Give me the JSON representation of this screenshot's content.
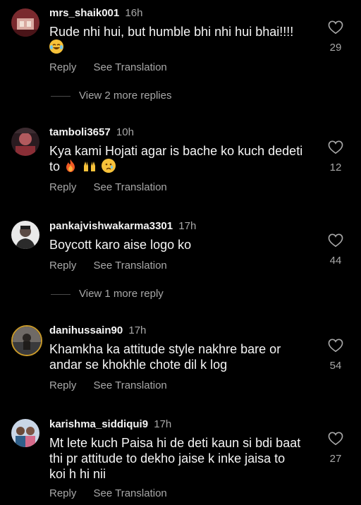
{
  "comments": [
    {
      "username": "mrs_shaik001",
      "time": "16h",
      "text": "Rude nhi hui, but humble bhi nhi hui bhai!!!!",
      "emoji": [
        "laughing-tears"
      ],
      "reply_label": "Reply",
      "translate_label": "See Translation",
      "likes": "29",
      "more_replies": "View 2 more replies"
    },
    {
      "username": "tamboli3657",
      "time": "10h",
      "text": "Kya kami Hojati agar is bache ko kuch dedeti to",
      "emoji": [
        "fire",
        "raised-hands",
        "crying-face"
      ],
      "reply_label": "Reply",
      "translate_label": "See Translation",
      "likes": "12"
    },
    {
      "username": "pankajvishwakarma3301",
      "time": "17h",
      "text": "Boycott karo aise logo ko",
      "reply_label": "Reply",
      "translate_label": "See Translation",
      "likes": "44",
      "more_replies": "View 1 more reply"
    },
    {
      "username": "danihussain90",
      "time": "17h",
      "text": "Khamkha ka attitude style nakhre bare or andar se khokhle chote dil k log",
      "reply_label": "Reply",
      "translate_label": "See Translation",
      "likes": "54"
    },
    {
      "username": "karishma_siddiqui9",
      "time": "17h",
      "text": "Mt lete kuch Paisa hi de deti kaun si bdi baat thi pr attitude to dekho jaise k inke jaisa to koi h hi nii",
      "reply_label": "Reply",
      "translate_label": "See Translation",
      "likes": "27"
    }
  ],
  "colors": {
    "background": "#000000",
    "primary_text": "#f5f5f5",
    "secondary_text": "#a8a8a8"
  }
}
